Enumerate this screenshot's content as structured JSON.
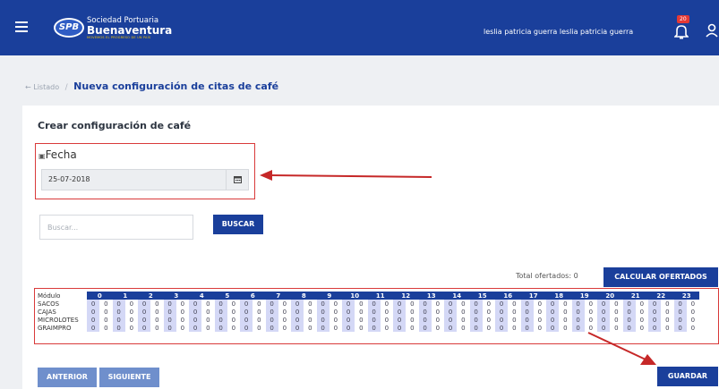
{
  "header": {
    "logo_initials": "SPB",
    "logo_line1": "Sociedad Portuaria",
    "logo_line2": "Buenaventura",
    "logo_line3": "MOVEMOS EL PROGRESO DE UN PAÍS",
    "username": "leslia patricia guerra leslia patricia guerra",
    "notifications_count": "20"
  },
  "breadcrumb": {
    "back_label": "← Listado",
    "separator": "/",
    "current": "Nueva configuración de citas de café"
  },
  "form": {
    "title": "Crear configuración de café",
    "fecha_label": "Fecha",
    "fecha_value": "25-07-2018",
    "search_placeholder": "Buscar...",
    "search_button": "BUSCAR",
    "total_label": "Total ofertados: 0",
    "calc_button": "CALCULAR OFERTADOS"
  },
  "grid": {
    "header_label": "Módulo",
    "hours": [
      "0",
      "1",
      "2",
      "3",
      "4",
      "5",
      "6",
      "7",
      "8",
      "9",
      "10",
      "11",
      "12",
      "13",
      "14",
      "15",
      "16",
      "17",
      "18",
      "19",
      "20",
      "21",
      "22",
      "23"
    ],
    "rows": [
      {
        "label": "SACOS",
        "values": [
          "0",
          "0",
          "0",
          "0",
          "0",
          "0",
          "0",
          "0",
          "0",
          "0",
          "0",
          "0",
          "0",
          "0",
          "0",
          "0",
          "0",
          "0",
          "0",
          "0",
          "0",
          "0",
          "0",
          "0",
          "0",
          "0",
          "0",
          "0",
          "0",
          "0",
          "0",
          "0",
          "0",
          "0",
          "0",
          "0",
          "0",
          "0",
          "0",
          "0",
          "0",
          "0",
          "0",
          "0",
          "0",
          "0",
          "0",
          "0"
        ]
      },
      {
        "label": "CAJAS",
        "values": [
          "0",
          "0",
          "0",
          "0",
          "0",
          "0",
          "0",
          "0",
          "0",
          "0",
          "0",
          "0",
          "0",
          "0",
          "0",
          "0",
          "0",
          "0",
          "0",
          "0",
          "0",
          "0",
          "0",
          "0",
          "0",
          "0",
          "0",
          "0",
          "0",
          "0",
          "0",
          "0",
          "0",
          "0",
          "0",
          "0",
          "0",
          "0",
          "0",
          "0",
          "0",
          "0",
          "0",
          "0",
          "0",
          "0",
          "0",
          "0"
        ]
      },
      {
        "label": "MICROLOTES",
        "values": [
          "0",
          "0",
          "0",
          "0",
          "0",
          "0",
          "0",
          "0",
          "0",
          "0",
          "0",
          "0",
          "0",
          "0",
          "0",
          "0",
          "0",
          "0",
          "0",
          "0",
          "0",
          "0",
          "0",
          "0",
          "0",
          "0",
          "0",
          "0",
          "0",
          "0",
          "0",
          "0",
          "0",
          "0",
          "0",
          "0",
          "0",
          "0",
          "0",
          "0",
          "0",
          "0",
          "0",
          "0",
          "0",
          "0",
          "0",
          "0"
        ]
      },
      {
        "label": "GRAIMPRO",
        "values": [
          "0",
          "0",
          "0",
          "0",
          "0",
          "0",
          "0",
          "0",
          "0",
          "0",
          "0",
          "0",
          "0",
          "0",
          "0",
          "0",
          "0",
          "0",
          "0",
          "0",
          "0",
          "0",
          "0",
          "0",
          "0",
          "0",
          "0",
          "0",
          "0",
          "0",
          "0",
          "0",
          "0",
          "0",
          "0",
          "0",
          "0",
          "0",
          "0",
          "0",
          "0",
          "0",
          "0",
          "0",
          "0",
          "0",
          "0",
          "0"
        ]
      }
    ]
  },
  "footer": {
    "prev_button": "ANTERIOR",
    "next_button": "SIGUIENTE",
    "save_button": "GUARDAR"
  },
  "colors": {
    "primary": "#1a3f9b",
    "highlight": "#d93a3a",
    "cell_fill": "#d4d8f6"
  }
}
